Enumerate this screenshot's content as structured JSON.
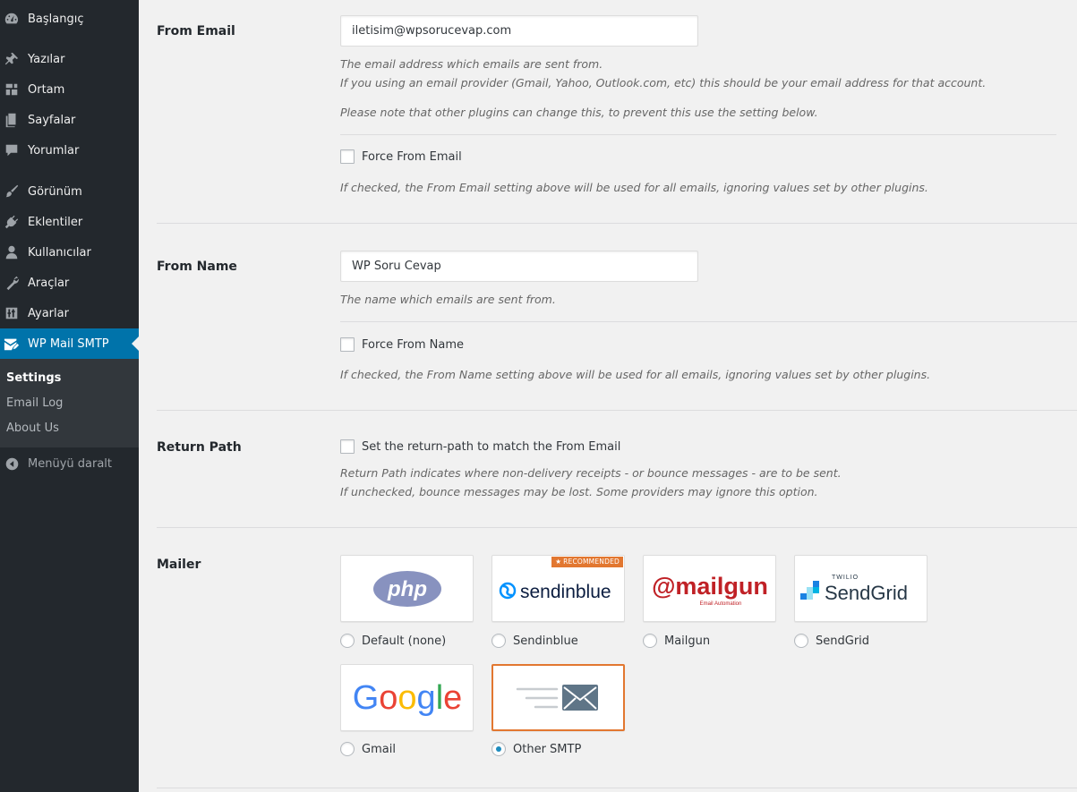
{
  "sidebar": {
    "items": [
      {
        "label": "Başlangıç",
        "icon": "dashboard-icon"
      },
      {
        "label": "Yazılar",
        "icon": "pin-icon"
      },
      {
        "label": "Ortam",
        "icon": "media-icon"
      },
      {
        "label": "Sayfalar",
        "icon": "pages-icon"
      },
      {
        "label": "Yorumlar",
        "icon": "comments-icon"
      },
      {
        "label": "Görünüm",
        "icon": "brush-icon"
      },
      {
        "label": "Eklentiler",
        "icon": "plugin-icon"
      },
      {
        "label": "Kullanıcılar",
        "icon": "users-icon"
      },
      {
        "label": "Araçlar",
        "icon": "wrench-icon"
      },
      {
        "label": "Ayarlar",
        "icon": "settings-icon"
      },
      {
        "label": "WP Mail SMTP",
        "icon": "mail-icon",
        "active": true
      }
    ],
    "submenu": [
      {
        "label": "Settings",
        "current": true
      },
      {
        "label": "Email Log"
      },
      {
        "label": "About Us"
      }
    ],
    "collapse_label": "Menüyü daralt"
  },
  "from_email": {
    "label": "From Email",
    "value": "iletisim@wpsorucevap.com",
    "desc_line1": "The email address which emails are sent from.",
    "desc_line2": "If you using an email provider (Gmail, Yahoo, Outlook.com, etc) this should be your email address for that account.",
    "note": "Please note that other plugins can change this, to prevent this use the setting below.",
    "force_label": "Force From Email",
    "force_checked": false,
    "force_desc": "If checked, the From Email setting above will be used for all emails, ignoring values set by other plugins."
  },
  "from_name": {
    "label": "From Name",
    "value": "WP Soru Cevap",
    "desc": "The name which emails are sent from.",
    "force_label": "Force From Name",
    "force_checked": false,
    "force_desc": "If checked, the From Name setting above will be used for all emails, ignoring values set by other plugins."
  },
  "return_path": {
    "label": "Return Path",
    "checkbox_label": "Set the return-path to match the From Email",
    "checked": false,
    "desc_line1": "Return Path indicates where non-delivery receipts - or bounce messages - are to be sent.",
    "desc_line2": "If unchecked, bounce messages may be lost. Some providers may ignore this option."
  },
  "mailer": {
    "label": "Mailer",
    "recommended_badge": "RECOMMENDED",
    "logos": {
      "php": "php",
      "sendinblue": "sendinblue",
      "mailgun": "@mailgun",
      "mailgun_sub": "Email Automation",
      "sendgrid_top": "TWILIO",
      "sendgrid": "SendGrid",
      "google": [
        "G",
        "o",
        "o",
        "g",
        "l",
        "e"
      ]
    },
    "options": [
      {
        "label": "Default (none)",
        "selected": false
      },
      {
        "label": "Sendinblue",
        "selected": false
      },
      {
        "label": "Mailgun",
        "selected": false
      },
      {
        "label": "SendGrid",
        "selected": false
      },
      {
        "label": "Gmail",
        "selected": false
      },
      {
        "label": "Other SMTP",
        "selected": true
      }
    ]
  },
  "colors": {
    "sidebar_bg": "#23282d",
    "active_blue": "#0073aa",
    "selected_orange": "#e27730"
  }
}
